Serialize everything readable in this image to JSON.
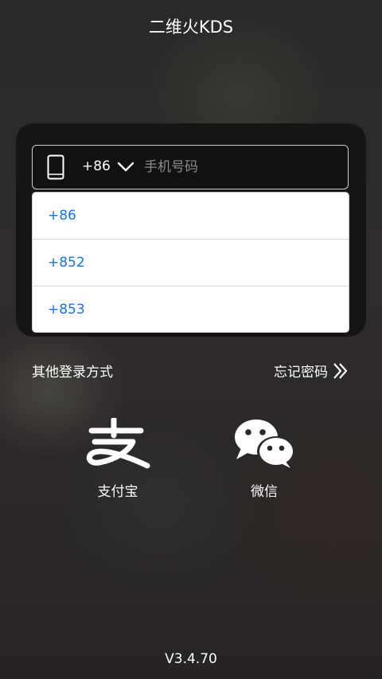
{
  "header": {
    "title": "二维火KDS"
  },
  "login_form": {
    "country_code": "+86",
    "phone_placeholder": "手机号码",
    "phone_value": ""
  },
  "country_dropdown": {
    "options": [
      "+86",
      "+852",
      "+853"
    ]
  },
  "links": {
    "other_login": "其他登录方式",
    "forgot_password": "忘记密码"
  },
  "third_party": {
    "alipay_label": "支付宝",
    "wechat_label": "微信"
  },
  "footer": {
    "version": "V3.4.70"
  },
  "colors": {
    "option_text": "#1a73e8",
    "card_bg": "#161515",
    "text": "#ffffff"
  },
  "icons": {
    "phone": "mobile-phone-icon",
    "dropdown": "chevron-down-icon",
    "forgot": "double-chevron-right-icon",
    "alipay": "alipay-icon",
    "wechat": "wechat-icon"
  }
}
